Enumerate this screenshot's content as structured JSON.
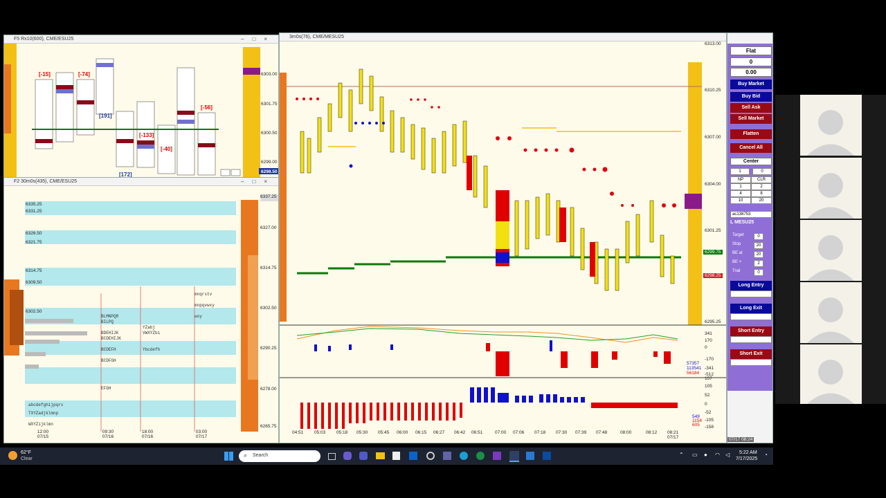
{
  "left_top_window": {
    "title": "F5 Rx10(600), CME/ESU25",
    "y_labels": [
      "6303.00",
      "6301.75",
      "6300.50",
      "6299.00",
      "6298.50"
    ],
    "annotations": [
      "[-15]",
      "[-74]",
      "[-133]",
      "[-40]",
      "[-56]",
      "[191]",
      "[172]"
    ]
  },
  "left_bottom_window": {
    "title": "F2 30m0s(435), CME/ESU25",
    "price_boxes": [
      "6335.25",
      "6331.25",
      "6326.50",
      "6321.75",
      "6314.75",
      "6309.50",
      "6302.50"
    ],
    "y_labels": [
      "6337.25",
      "6327.00",
      "6314.75",
      "6302.50",
      "6290.25",
      "6278.00",
      "6265.75"
    ],
    "x_labels": [
      {
        "time": "12:00",
        "date": "07/15"
      },
      {
        "time": "09:30",
        "date": "07/16"
      },
      {
        "time": "18:00",
        "date": "07/16"
      },
      {
        "time": "03:00",
        "date": "07/17"
      }
    ]
  },
  "main_window": {
    "title": "3m0s(76), CME/MESU25",
    "y_labels": [
      "6313.00",
      "6310.25",
      "6307.00",
      "6304.00",
      "6301.25",
      "6299.75",
      "6298.25",
      "6295.25"
    ],
    "price_tag_green": "6299.75",
    "price_tag_red": "6298.25",
    "osc1_labels": [
      "341",
      "170",
      "0",
      "-170",
      "-341",
      "-512"
    ],
    "osc1_values": [
      "57357",
      "113541",
      "56184"
    ],
    "osc2_labels": [
      "157",
      "105",
      "52",
      "0",
      "-52",
      "-105",
      "-158"
    ],
    "osc2_values": [
      "549",
      "1154",
      "605"
    ],
    "x_labels": [
      "04:51",
      "05:03",
      "05:18",
      "05:30",
      "05:45",
      "06:00",
      "06:15",
      "06:27",
      "06:42",
      "06:51",
      "07:00",
      "07:06",
      "07:18",
      "07:30",
      "07:39",
      "07:48",
      "08:00",
      "08:12",
      "08:21"
    ],
    "x_last_date": "07/17",
    "date_footer": "07/17 08:24"
  },
  "order_panel": {
    "position": "Flat",
    "qty": "0",
    "pnl": "0.00",
    "buttons": {
      "buy_market": "Buy Market",
      "buy_bid": "Buy Bid",
      "sell_ask": "Sell Ask",
      "sell_market": "Sell Market",
      "flatten": "Flatten",
      "cancel_all": "Cancel All",
      "center": "Center"
    },
    "qty_grid": [
      [
        "1",
        "0"
      ],
      [
        "NP",
        "CLR"
      ],
      [
        "1",
        "2"
      ],
      [
        "4",
        "8"
      ],
      [
        "10",
        "20"
      ]
    ],
    "account": "ac138753",
    "symbol": "L MESU25",
    "params": [
      {
        "label": "Target",
        "value": "0"
      },
      {
        "label": "Stop",
        "value": "20"
      },
      {
        "label": "BE at",
        "value": "20"
      },
      {
        "label": "BE +",
        "value": "2"
      },
      {
        "label": "Trail",
        "value": "0"
      }
    ],
    "entry_exit": [
      "Long Entry",
      "Long Exit",
      "Short Entry",
      "Short Exit"
    ]
  },
  "taskbar": {
    "weather_temp": "62°F",
    "weather_desc": "Clear",
    "search_placeholder": "Search",
    "time": "5:22 AM",
    "date": "7/17/2025"
  },
  "colors": {
    "panel_purple": "#8f6fd6",
    "btn_blue": "#0a0a9a",
    "btn_red": "#9a0a14",
    "profile_orange": "#e87820",
    "profile_yellow": "#f3c016",
    "chart_bg": "#fffbea"
  }
}
